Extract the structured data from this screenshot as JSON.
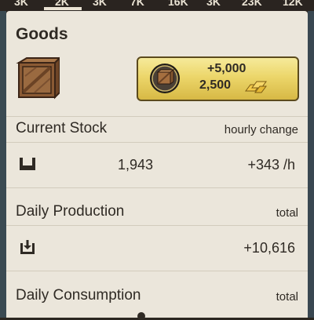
{
  "top_strip": {
    "values": [
      "3K",
      "2K",
      "3K",
      "7K",
      "16K",
      "3K",
      "23K",
      "12K"
    ],
    "selected_index": 1
  },
  "panel": {
    "title": "Goods",
    "reward": {
      "amount_top": "+5,000",
      "amount_bottom": "2,500"
    },
    "current_stock": {
      "label": "Current Stock",
      "hint": "hourly change",
      "value": "1,943",
      "change": "+343 /h"
    },
    "daily_production": {
      "label": "Daily Production",
      "hint": "total",
      "value": "+10,616"
    },
    "daily_consumption": {
      "label": "Daily Consumption",
      "hint": "total"
    }
  },
  "colors": {
    "panel_bg": "#ebe6db",
    "reward_gold": "#ecd66a",
    "text": "#2f2a24",
    "dark_top": "#2a2420"
  },
  "icons": [
    "crate-icon",
    "crate-coin-icon",
    "gold-bars-icon",
    "storage-icon",
    "download-box-icon"
  ]
}
